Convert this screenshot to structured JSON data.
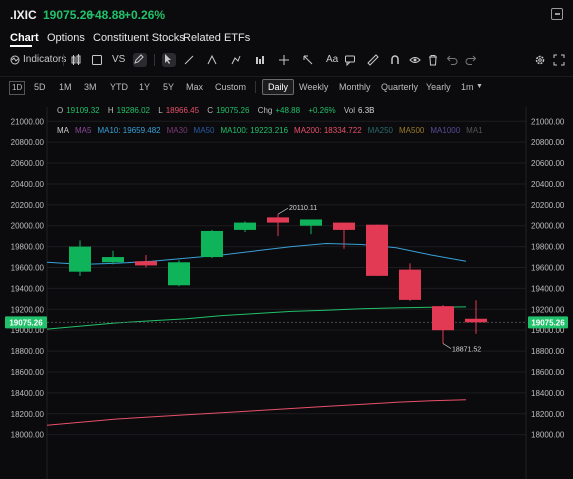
{
  "header": {
    "symbol": ".IXIC",
    "price": "19075.26",
    "change": "+48.88",
    "change_pct": "+0.26%"
  },
  "tabs": [
    {
      "label": "Chart"
    },
    {
      "label": "Options"
    },
    {
      "label": "Constituent Stocks"
    },
    {
      "label": "Related ETFs"
    }
  ],
  "toolbar": {
    "indicators_label": "Indicators",
    "vs_label": "VS",
    "text_tool_label": "Aa"
  },
  "periods": [
    "1D",
    "5D",
    "1M",
    "3M",
    "YTD",
    "1Y",
    "5Y",
    "Max",
    "Custom",
    "Daily",
    "Weekly",
    "Monthly",
    "Quarterly",
    "Yearly",
    "1m"
  ],
  "legend": {
    "open_label": "O",
    "open": "19109.32",
    "high_label": "H",
    "high": "19286.02",
    "low_label": "L",
    "low": "18966.45",
    "close_label": "C",
    "close": "19075.26",
    "chg_label": "Chg",
    "chg": "+48.88",
    "chg_pct": "+0.26%",
    "vol_label": "Vol",
    "vol": "6.3B"
  },
  "ma_legend": [
    {
      "label": "MA",
      "color": "#cfcfcf"
    },
    {
      "label": "MA5",
      "color": "#8a4a9a"
    },
    {
      "label": "MA10: 19659.482",
      "color": "#3aa0d8"
    },
    {
      "label": "MA30",
      "color": "#7a3a7a"
    },
    {
      "label": "MA50",
      "color": "#2a5aa0"
    },
    {
      "label": "MA100: 19223.216",
      "color": "#21c16b"
    },
    {
      "label": "MA200: 18334.722",
      "color": "#e8506a"
    },
    {
      "label": "MA250",
      "color": "#2a6a6a"
    },
    {
      "label": "MA500",
      "color": "#9a7a2a"
    },
    {
      "label": "MA1000",
      "color": "#5a4a9a"
    },
    {
      "label": "MA1",
      "color": "#555555"
    }
  ],
  "colors": {
    "up": "#0fb45a",
    "down": "#e23a55",
    "ma10": "#3aa0d8",
    "ma100": "#21c16b",
    "ma200": "#e8506a",
    "grid": "#1d1d20"
  },
  "chart_data": {
    "type": "candlestick",
    "y_ticks": [
      21000,
      20800,
      20600,
      20400,
      20200,
      20000,
      19800,
      19600,
      19400,
      19200,
      19000,
      18800,
      18600,
      18400,
      18200,
      18000
    ],
    "ylim": [
      17920,
      21060
    ],
    "candles": [
      {
        "o": 19560,
        "h": 19860,
        "l": 19520,
        "c": 19800
      },
      {
        "o": 19650,
        "h": 19760,
        "l": 19630,
        "c": 19700
      },
      {
        "o": 19660,
        "h": 19720,
        "l": 19600,
        "c": 19620
      },
      {
        "o": 19430,
        "h": 19670,
        "l": 19420,
        "c": 19650
      },
      {
        "o": 19700,
        "h": 19960,
        "l": 19690,
        "c": 19950
      },
      {
        "o": 19960,
        "h": 20040,
        "l": 19940,
        "c": 20030
      },
      {
        "o": 20080,
        "h": 20110.11,
        "l": 19900,
        "c": 20030
      },
      {
        "o": 20000,
        "h": 20060,
        "l": 19920,
        "c": 20060
      },
      {
        "o": 20030,
        "h": 20030,
        "l": 19780,
        "c": 19960
      },
      {
        "o": 20010,
        "h": 20010,
        "l": 19520,
        "c": 19520
      },
      {
        "o": 19580,
        "h": 19640,
        "l": 19280,
        "c": 19290
      },
      {
        "o": 19230,
        "h": 19240,
        "l": 18871.52,
        "c": 19000
      },
      {
        "o": 19109.32,
        "h": 19286.02,
        "l": 18966.45,
        "c": 19075.26
      }
    ],
    "high_annotation": "20110.11",
    "low_annotation": "18871.52",
    "last_price_label": "19075.26",
    "ma10": [
      19650,
      19630,
      19640,
      19660,
      19690,
      19720,
      19760,
      19800,
      19830,
      19820,
      19790,
      19720,
      19660
    ],
    "ma100": [
      19010,
      19040,
      19070,
      19090,
      19110,
      19140,
      19160,
      19180,
      19190,
      19205,
      19213,
      19220,
      19223.216
    ],
    "ma200": [
      18090,
      18120,
      18150,
      18170,
      18190,
      18210,
      18230,
      18250,
      18270,
      18290,
      18310,
      18325,
      18334.722
    ]
  }
}
